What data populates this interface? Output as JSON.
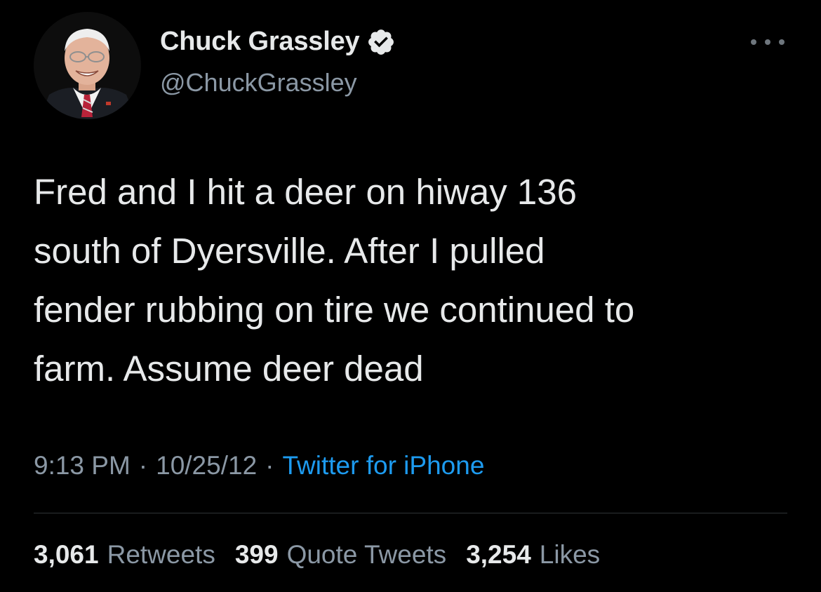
{
  "author": {
    "display_name": "Chuck Grassley",
    "handle": "@ChuckGrassley",
    "verified": true,
    "verified_icon": "verified-badge-icon"
  },
  "tweet": {
    "text": "Fred and I hit a deer on hiway 136\nsouth of Dyersville. After I pulled\nfender rubbing on tire we continued to\nfarm. Assume deer dead",
    "time": "9:13 PM",
    "date": "10/25/12",
    "separator": "·",
    "source": "Twitter for iPhone"
  },
  "stats": {
    "retweets": {
      "count": "3,061",
      "label": "Retweets"
    },
    "quote_tweets": {
      "count": "399",
      "label": "Quote Tweets"
    },
    "likes": {
      "count": "3,254",
      "label": "Likes"
    }
  },
  "colors": {
    "background": "#000000",
    "text_primary": "#e7e9ea",
    "text_secondary": "#8b98a5",
    "link": "#1d9bf0",
    "divider": "#2f3336"
  }
}
